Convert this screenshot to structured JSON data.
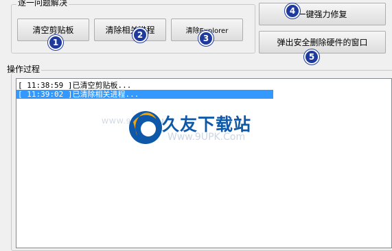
{
  "group1": {
    "title": "逐一问题解决",
    "buttons": [
      {
        "label": "清空剪贴板",
        "badge": "1"
      },
      {
        "label": "清除相关进程",
        "badge": "2"
      },
      {
        "label": "清除Explorer",
        "badge": "3"
      }
    ]
  },
  "right_buttons": [
    {
      "label": "一键强力修复",
      "badge": "4"
    },
    {
      "label": "弹出安全删除硬件的窗口",
      "badge": "5"
    }
  ],
  "log": {
    "title": "操作过程",
    "lines": [
      "[ 11:38:59 ]已清空剪贴板...",
      "[ 11:39:02 ]已清除相关进程..."
    ]
  },
  "watermark": {
    "brand": "久友下载站",
    "url": "Www.9UPK.Com",
    "left_text": "WWW.9UPK.COM"
  },
  "colors": {
    "badge": "#1f3a9e",
    "selection": "#3399ff",
    "brand": "#0d58a8"
  }
}
